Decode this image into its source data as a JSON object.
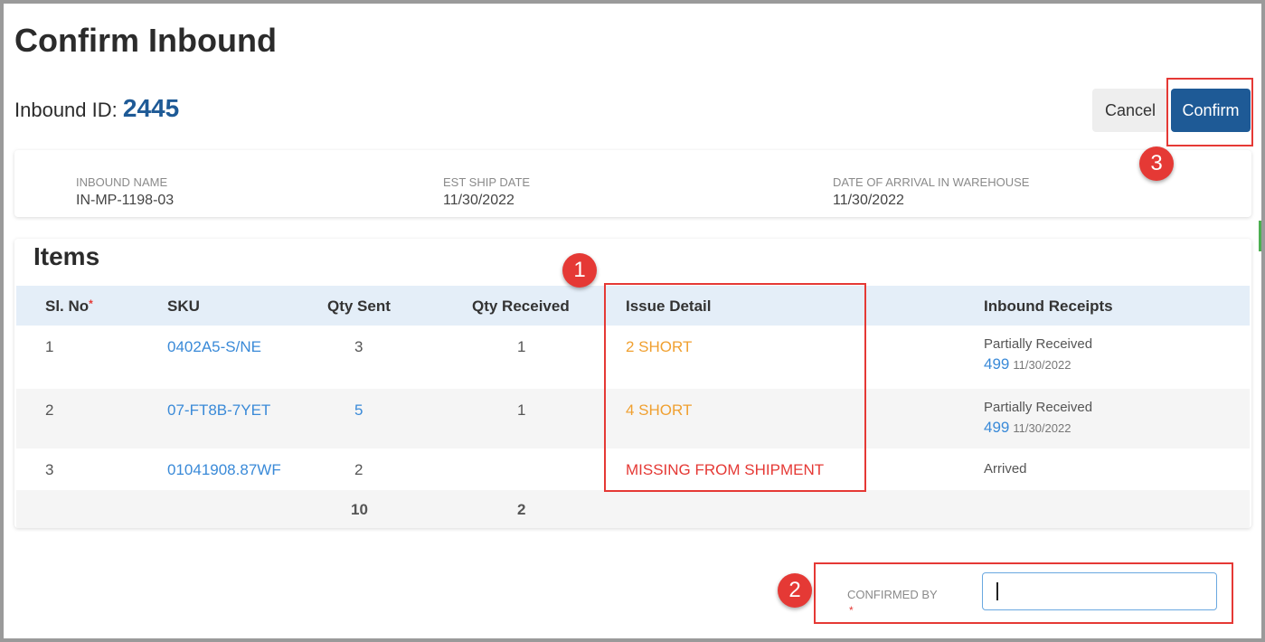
{
  "page": {
    "title": "Confirm Inbound",
    "inbound_id_label": "Inbound ID:",
    "inbound_id_value": "2445"
  },
  "actions": {
    "cancel_label": "Cancel",
    "confirm_label": "Confirm"
  },
  "info": {
    "name_label": "INBOUND NAME",
    "name_value": "IN-MP-1198-03",
    "ship_label": "EST SHIP DATE",
    "ship_value": "11/30/2022",
    "arrival_label": "DATE OF ARRIVAL IN WAREHOUSE",
    "arrival_value": "11/30/2022"
  },
  "items": {
    "title": "Items",
    "headers": {
      "sl": "Sl. No",
      "sl_required": "*",
      "sku": "SKU",
      "qty_sent": "Qty Sent",
      "qty_received": "Qty Received",
      "issue": "Issue Detail",
      "receipts": "Inbound Receipts"
    },
    "rows": [
      {
        "sl": "1",
        "sku": "0402A5-S/NE",
        "qty_sent": "3",
        "qty_received": "1",
        "issue": "2 SHORT",
        "receipt_status": "Partially Received",
        "receipt_num": "499",
        "receipt_date": "11/30/2022"
      },
      {
        "sl": "2",
        "sku": "07-FT8B-7YET",
        "qty_sent": "5",
        "qty_received": "1",
        "issue": "4 SHORT",
        "receipt_status": "Partially Received",
        "receipt_num": "499",
        "receipt_date": "11/30/2022"
      },
      {
        "sl": "3",
        "sku": "01041908.87WF",
        "qty_sent": "2",
        "qty_received": "",
        "issue": "MISSING FROM SHIPMENT",
        "receipt_status": "Arrived",
        "receipt_num": "",
        "receipt_date": ""
      }
    ],
    "totals": {
      "qty_sent": "10",
      "qty_received": "2"
    }
  },
  "confirmed_by": {
    "label": "CONFIRMED BY",
    "required": "*",
    "value": ""
  },
  "annotations": {
    "badge_1": "1",
    "badge_2": "2",
    "badge_3": "3"
  },
  "colors": {
    "primary": "#1e5a96",
    "link": "#3a8ad8",
    "warning": "#f0a030",
    "error": "#e53935"
  }
}
